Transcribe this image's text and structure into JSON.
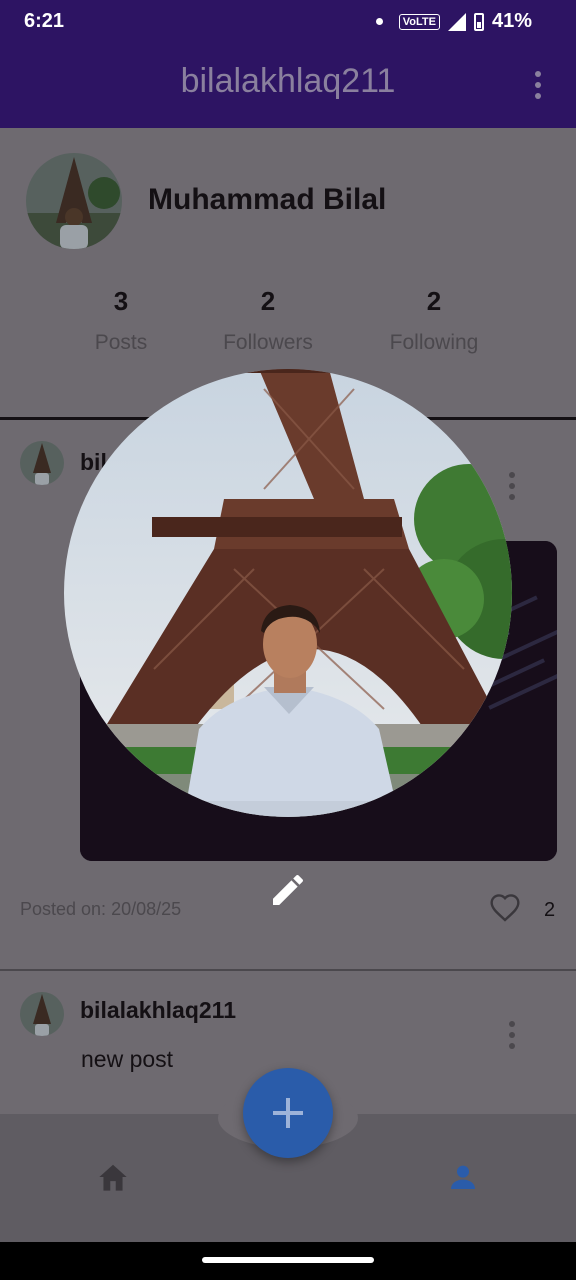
{
  "status": {
    "time": "6:21",
    "network": "VoLTE",
    "battery": "41%"
  },
  "appbar": {
    "title": "bilalakhlaq211",
    "menu_icon": "more-vert-icon"
  },
  "profile": {
    "name": "Muhammad Bilal",
    "stats": [
      {
        "count": "3",
        "label": "Posts"
      },
      {
        "count": "2",
        "label": "Followers"
      },
      {
        "count": "2",
        "label": "Following"
      }
    ]
  },
  "posts": [
    {
      "username": "bilalakhlaq211",
      "username_visible": "bil",
      "posted_on": "Posted on: 20/08/25",
      "likes": "2"
    },
    {
      "username": "bilalakhlaq211",
      "text": "new post"
    }
  ],
  "bottom_nav": {
    "home_icon": "home-icon",
    "profile_icon": "person-icon",
    "fab_icon": "add-icon",
    "active_color": "#2a5caa"
  },
  "overlay": {
    "edit_icon": "edit-pencil-icon"
  }
}
